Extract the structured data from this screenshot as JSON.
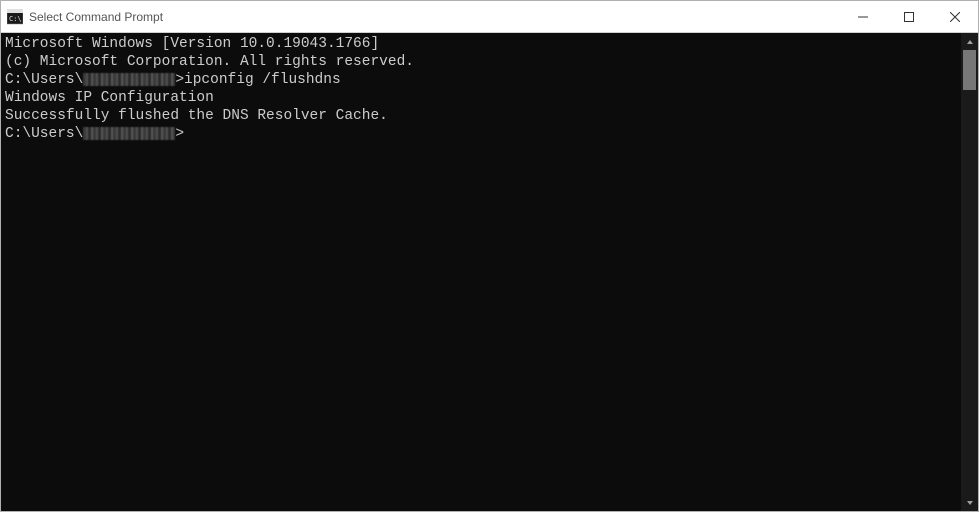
{
  "window": {
    "title": "Select Command Prompt"
  },
  "terminal": {
    "line1": "Microsoft Windows [Version 10.0.19043.1766]",
    "line2": "(c) Microsoft Corporation. All rights reserved.",
    "blank1": "",
    "prompt1_prefix": "C:\\Users\\",
    "prompt1_suffix": ">ipconfig /flushdns",
    "blank2": "",
    "line3": "Windows IP Configuration",
    "blank3": "",
    "line4": "Successfully flushed the DNS Resolver Cache.",
    "blank4": "",
    "prompt2_prefix": "C:\\Users\\",
    "prompt2_suffix": ">"
  }
}
